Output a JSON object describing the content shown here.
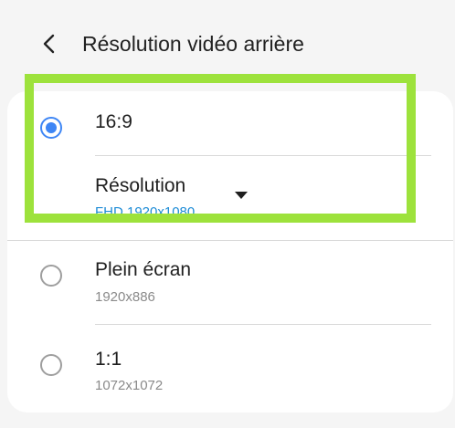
{
  "header": {
    "back_icon": "chevron-left-icon",
    "title": "Résolution vidéo arrière"
  },
  "options": [
    {
      "label": "16:9",
      "selected": true
    },
    {
      "label": "Plein écran",
      "sub": "1920x886",
      "selected": false
    },
    {
      "label": "1:1",
      "sub": "1072x1072",
      "selected": false
    }
  ],
  "resolution": {
    "label": "Résolution",
    "value": "FHD 1920x1080",
    "dropdown_icon": "caret-down-icon"
  },
  "colors": {
    "accent": "#3e86f5",
    "value_text": "#1e8cd6",
    "highlight": "#9de23c"
  }
}
